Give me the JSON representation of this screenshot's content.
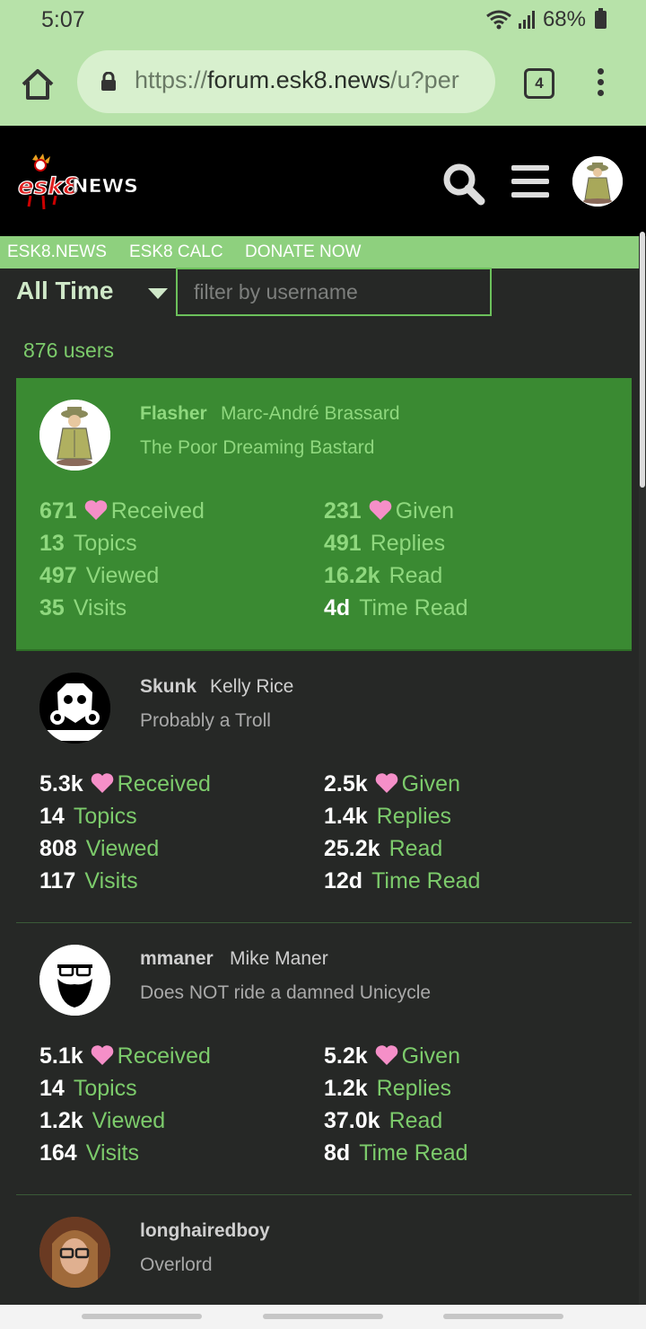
{
  "statusbar": {
    "time": "5:07",
    "battery": "68%"
  },
  "browser": {
    "url_prefix": "https://",
    "url_host": "forum.esk8.news",
    "url_path": "/u?per",
    "tab_count": "4"
  },
  "header": {
    "logo_text": "ESK8NEWS"
  },
  "nav": {
    "links": [
      "ESK8.NEWS",
      "ESK8 CALC",
      "DONATE NOW"
    ]
  },
  "filters": {
    "period": "All Time",
    "search_placeholder": "filter by username"
  },
  "summary": {
    "user_count": "876 users"
  },
  "colors": {
    "accent": "#7ccb6b",
    "highlight_bg": "#3a8a32",
    "heart": "#f58fc8",
    "background": "#262826"
  },
  "users": [
    {
      "username": "Flasher",
      "full_name": "Marc-André Brassard",
      "title": "The Poor Dreaming Bastard",
      "stats": {
        "received": "671",
        "received_label": "Received",
        "given": "231",
        "given_label": "Given",
        "topics": "13",
        "topics_label": "Topics",
        "replies": "491",
        "replies_label": "Replies",
        "viewed": "497",
        "viewed_label": "Viewed",
        "read": "16.2k",
        "read_label": "Read",
        "visits": "35",
        "visits_label": "Visits",
        "time_read": "4d",
        "time_read_label": "Time Read"
      }
    },
    {
      "username": "Skunk",
      "full_name": "Kelly Rice",
      "title": "Probably a Troll",
      "stats": {
        "received": "5.3k",
        "received_label": "Received",
        "given": "2.5k",
        "given_label": "Given",
        "topics": "14",
        "topics_label": "Topics",
        "replies": "1.4k",
        "replies_label": "Replies",
        "viewed": "808",
        "viewed_label": "Viewed",
        "read": "25.2k",
        "read_label": "Read",
        "visits": "117",
        "visits_label": "Visits",
        "time_read": "12d",
        "time_read_label": "Time Read"
      }
    },
    {
      "username": "mmaner",
      "full_name": "Mike Maner",
      "title": "Does NOT ride a damned Unicycle",
      "stats": {
        "received": "5.1k",
        "received_label": "Received",
        "given": "5.2k",
        "given_label": "Given",
        "topics": "14",
        "topics_label": "Topics",
        "replies": "1.2k",
        "replies_label": "Replies",
        "viewed": "1.2k",
        "viewed_label": "Viewed",
        "read": "37.0k",
        "read_label": "Read",
        "visits": "164",
        "visits_label": "Visits",
        "time_read": "8d",
        "time_read_label": "Time Read"
      }
    },
    {
      "username": "longhairedboy",
      "title": "Overlord"
    }
  ]
}
